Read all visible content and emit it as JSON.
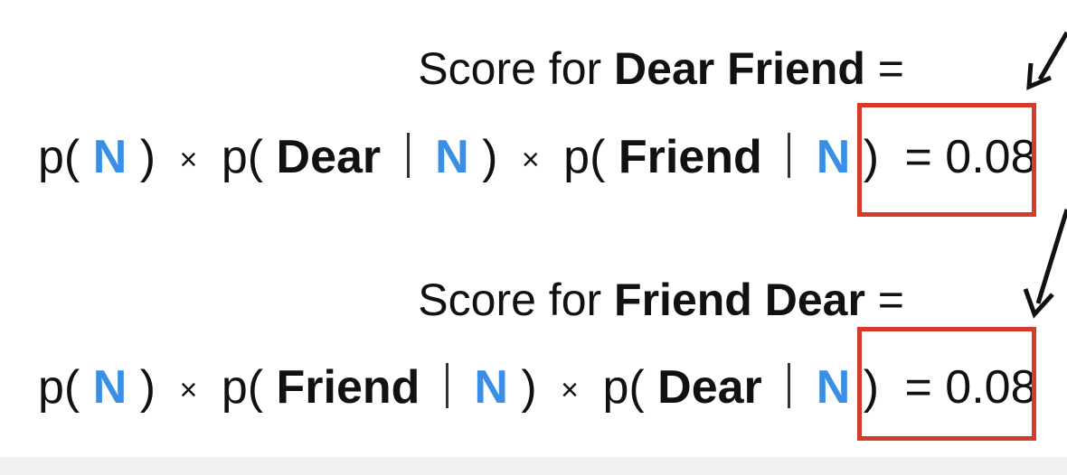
{
  "slide": {
    "block1": {
      "title_prefix": "Score for ",
      "title_bold": "Dear Friend",
      "title_suffix": " =",
      "equation": {
        "p1_open": "p(",
        "p1_label": "N",
        "p1_close": ")",
        "times1": "×",
        "p2_open": "p(",
        "p2_word": "Dear",
        "p2_label": "N",
        "p2_close": ")",
        "times2": "×",
        "p3_open": "p(",
        "p3_word": "Friend",
        "p3_label": "N",
        "p3_close": ")",
        "result": "= 0.08"
      }
    },
    "block2": {
      "title_prefix": "Score for ",
      "title_bold": "Friend Dear",
      "title_suffix": " =",
      "equation": {
        "p1_open": "p(",
        "p1_label": "N",
        "p1_close": ")",
        "times1": "×",
        "p2_open": "p(",
        "p2_word": "Friend",
        "p2_label": "N",
        "p2_close": ")",
        "times2": "×",
        "p3_open": "p(",
        "p3_word": "Dear",
        "p3_label": "N",
        "p3_close": ")",
        "result": "= 0.08"
      }
    },
    "colors": {
      "label_blue": "#3a8ee6",
      "highlight_red": "#d63a2a",
      "text": "#111111"
    }
  }
}
